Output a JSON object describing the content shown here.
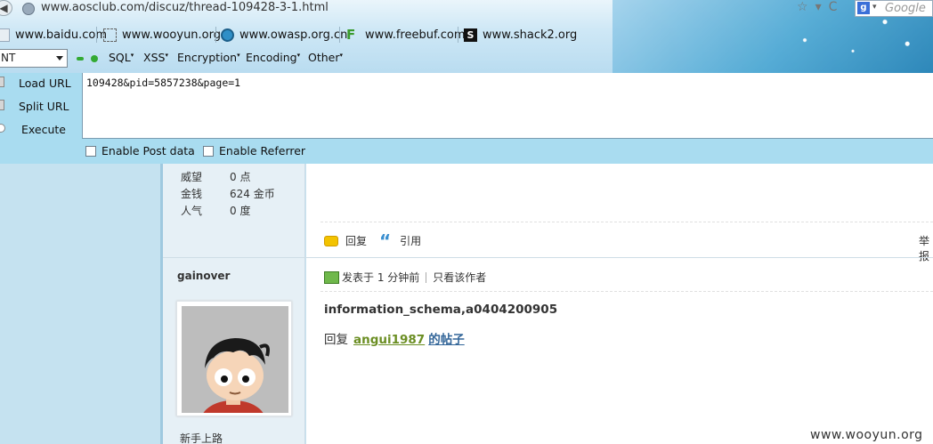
{
  "browser": {
    "url": "www.aosclub.com/discuz/thread-109428-3-1.html",
    "star": "☆",
    "dropdown": "▾",
    "reload": "C",
    "search_engine_letter": "g",
    "search_dropdown": "▾",
    "search_placeholder": "Google"
  },
  "bookmarks": [
    {
      "label": "www.baidu.com",
      "icon": "baidu-icon"
    },
    {
      "label": "www.wooyun.org",
      "icon": "wooyun-icon"
    },
    {
      "label": "www.owasp.org.cn",
      "icon": "owasp-icon"
    },
    {
      "label": "www.freebuf.com",
      "icon": "freebuf-icon"
    },
    {
      "label": "www.shack2.org",
      "icon": "shack2-icon"
    }
  ],
  "hackbar": {
    "select_value": "NT",
    "menus": [
      "SQL",
      "XSS",
      "Encryption",
      "Encoding",
      "Other"
    ],
    "buttons": {
      "load": "Load URL",
      "split": "Split URL",
      "execute": "Execute"
    },
    "url_value": "109428&pid=5857238&page=1",
    "enable_post": "Enable Post data",
    "enable_referrer": "Enable Referrer"
  },
  "profile_stats": [
    {
      "label": "威望",
      "value": "0 点"
    },
    {
      "label": "金钱",
      "value": "624 金币"
    },
    {
      "label": "人气",
      "value": "0 度"
    }
  ],
  "actions": {
    "reply": "回复",
    "quote": "引用",
    "quote_glyph": "“",
    "report": "举报"
  },
  "post": {
    "author": "gainover",
    "posted_at": "发表于 1 分钟前",
    "only_author": "只看该作者",
    "title": "information_schema,a0404200905",
    "reply_prefix": "回复",
    "reply_user": "angui1987",
    "reply_suffix": "的帖子",
    "rank": "新手上路"
  },
  "watermark": "www.wooyun.org",
  "colors": {
    "hackbar_bg": "#a9dcf0",
    "page_left_bg": "#c5e2f0",
    "reply_user": "#6b8e23",
    "link": "#336699"
  }
}
